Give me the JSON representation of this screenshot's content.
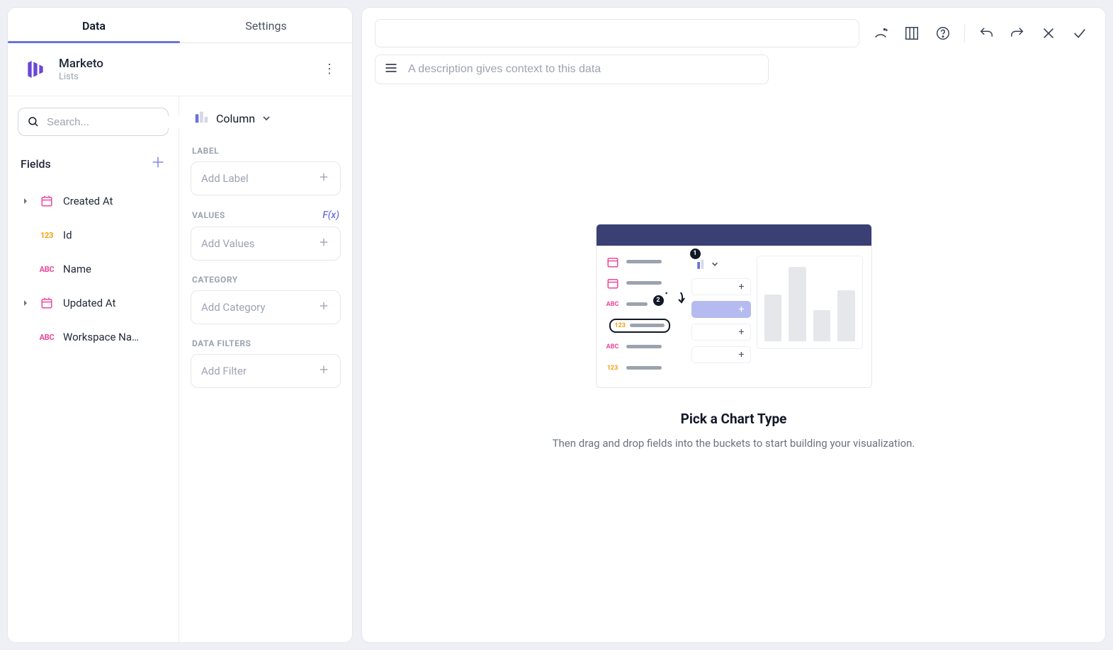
{
  "tabs": {
    "data": "Data",
    "settings": "Settings"
  },
  "source": {
    "name": "Marketo",
    "subtitle": "Lists"
  },
  "search": {
    "placeholder": "Search..."
  },
  "fields_header": "Fields",
  "fields": [
    {
      "type": "date",
      "label": "Created At",
      "expandable": true
    },
    {
      "type": "123",
      "label": "Id",
      "expandable": false
    },
    {
      "type": "abc",
      "label": "Name",
      "expandable": false
    },
    {
      "type": "date",
      "label": "Updated At",
      "expandable": true
    },
    {
      "type": "abc",
      "label": "Workspace Na…",
      "expandable": false
    }
  ],
  "chart_type": "Column",
  "sections": {
    "label": {
      "title": "LABEL",
      "placeholder": "Add Label"
    },
    "values": {
      "title": "VALUES",
      "placeholder": "Add Values",
      "fx": "F(x)"
    },
    "category": {
      "title": "CATEGORY",
      "placeholder": "Add Category"
    },
    "data_filters": {
      "title": "DATA FILTERS",
      "placeholder": "Add Filter"
    }
  },
  "description": {
    "placeholder": "A description gives context to this data"
  },
  "empty_state": {
    "title": "Pick a Chart Type",
    "subtitle": "Then drag and drop fields into the buckets to start building your visualization."
  }
}
